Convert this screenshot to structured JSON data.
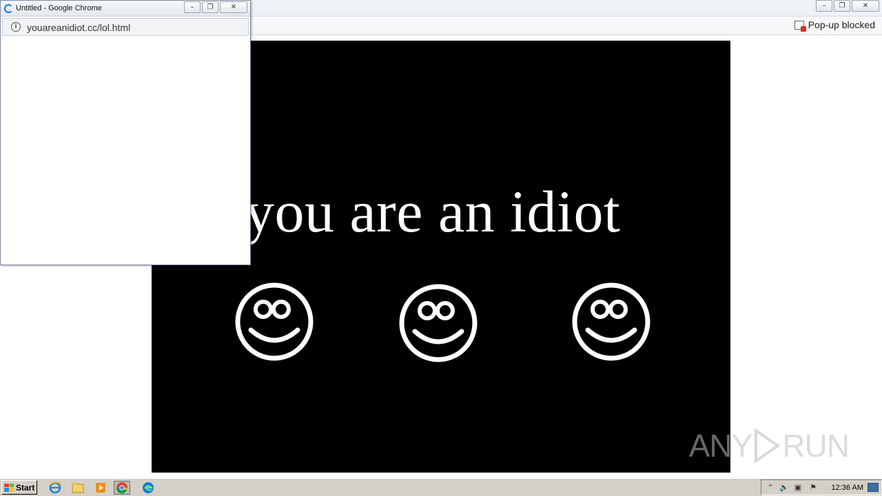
{
  "popup_window": {
    "title": "Untitled - Google Chrome",
    "url": "youareanidiot.cc/lol.html",
    "controls": {
      "minimize": "–",
      "restore": "❐",
      "close": "✕"
    }
  },
  "main_window": {
    "popup_blocked_label": "Pop-up blocked",
    "controls": {
      "minimize": "–",
      "restore": "❐",
      "close": "✕"
    }
  },
  "page": {
    "headline": "you are an idiot",
    "background_color": "#000000",
    "text_color": "#ffffff",
    "smiley_count": 3
  },
  "watermark": {
    "text_left": "ANY",
    "text_right": "RUN"
  },
  "taskbar": {
    "start_label": "Start",
    "pinned": [
      "internet-explorer-icon",
      "file-explorer-icon",
      "media-player-icon",
      "chrome-icon",
      "edge-icon"
    ],
    "active_app": "chrome-icon",
    "tray": {
      "icons": [
        "chevron-up-icon",
        "volume-icon",
        "network-icon",
        "flag-icon"
      ],
      "clock": "12:36 AM"
    }
  }
}
